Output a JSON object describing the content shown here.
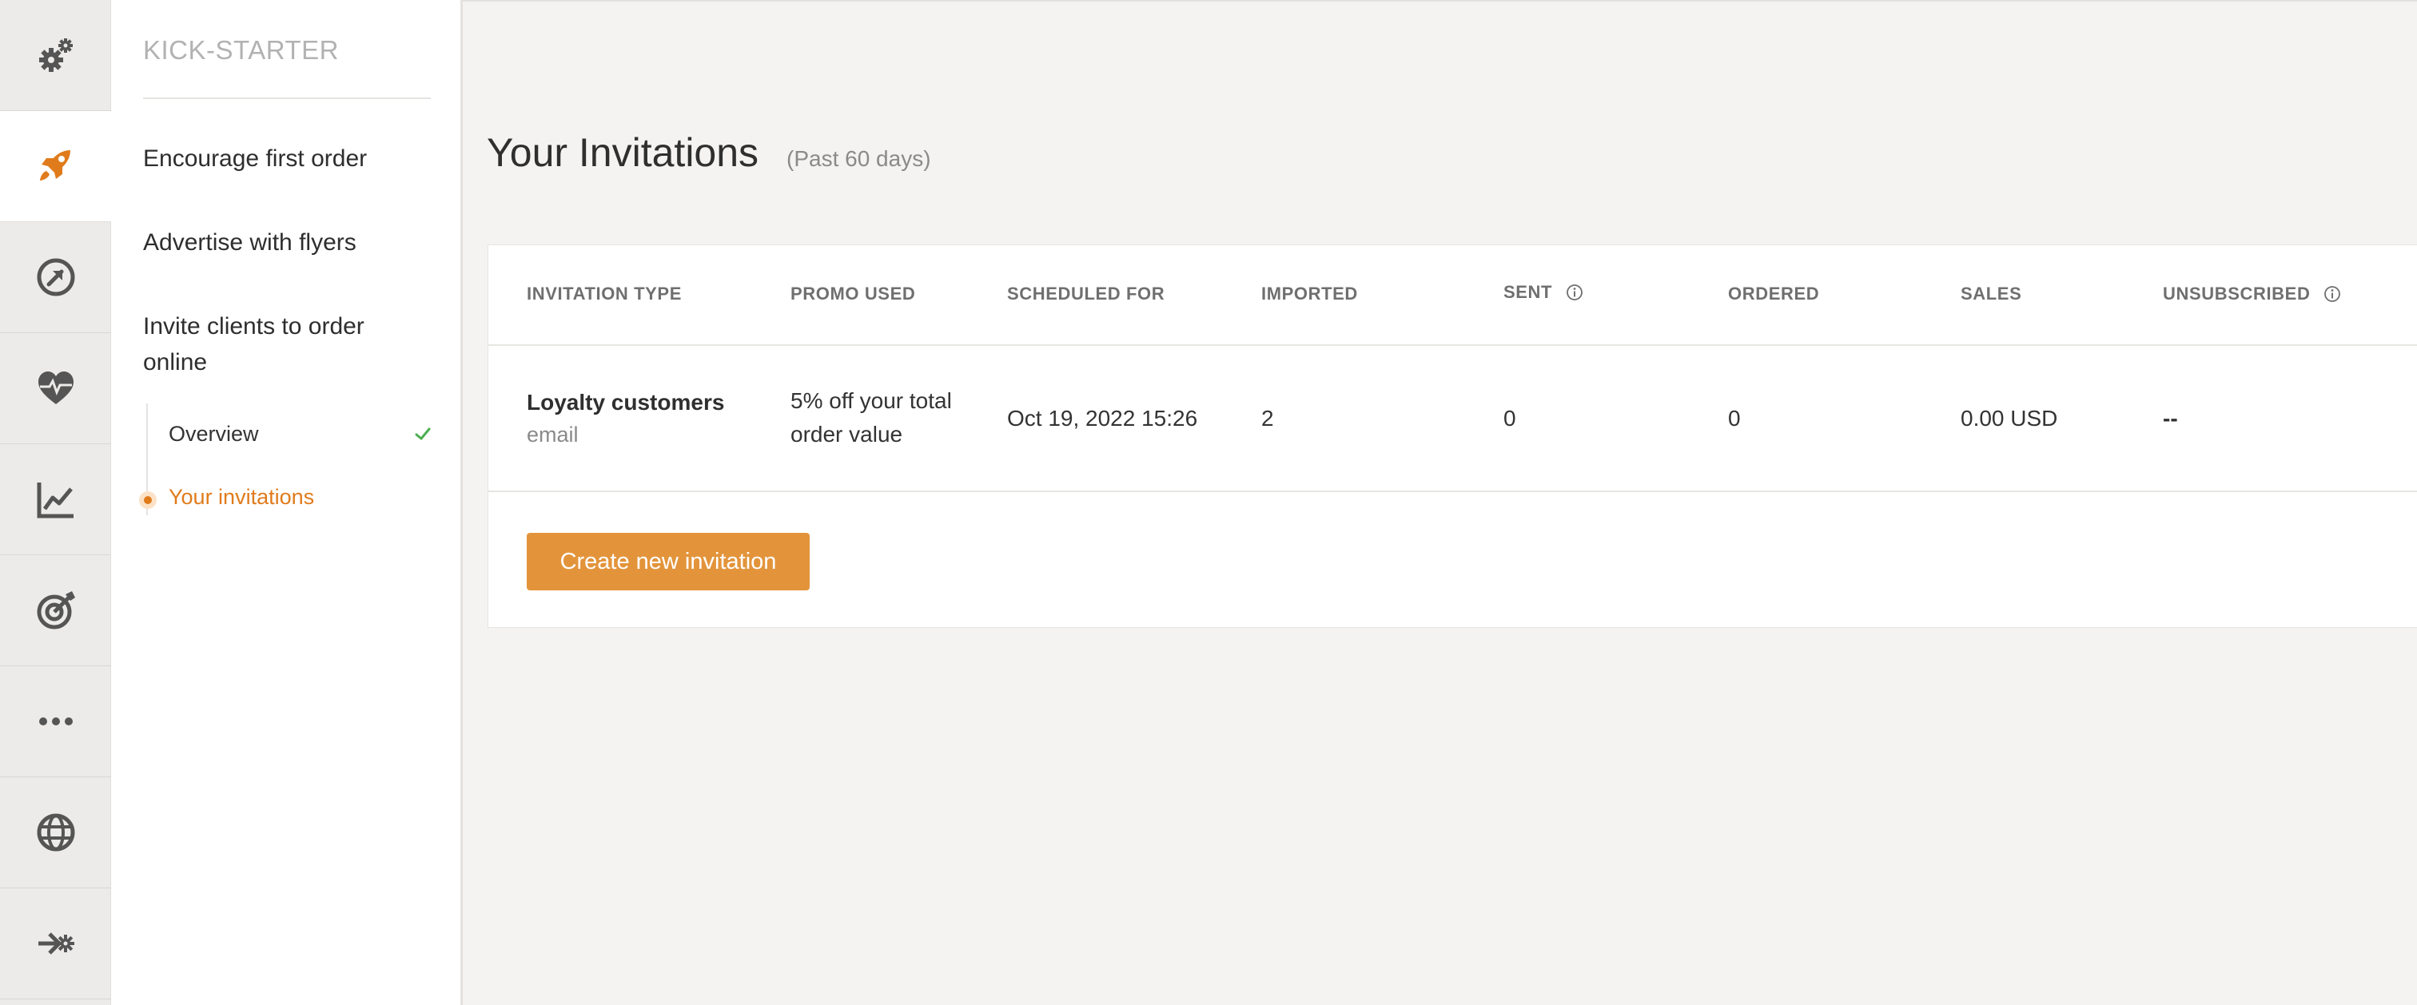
{
  "rail": {
    "items": [
      {
        "icon": "gears-icon",
        "active": false
      },
      {
        "icon": "rocket-icon",
        "active": true
      },
      {
        "icon": "arrow-circle-icon",
        "active": false
      },
      {
        "icon": "heart-pulse-icon",
        "active": false
      },
      {
        "icon": "line-chart-icon",
        "active": false
      },
      {
        "icon": "target-icon",
        "active": false
      },
      {
        "icon": "more-icon",
        "active": false
      },
      {
        "icon": "globe-icon",
        "active": false
      },
      {
        "icon": "integrations-icon",
        "active": false
      }
    ]
  },
  "subnav": {
    "title": "KICK-STARTER",
    "links": [
      {
        "label": "Encourage first order"
      },
      {
        "label": "Advertise with flyers"
      },
      {
        "label": "Invite clients to order online"
      }
    ],
    "subitems": [
      {
        "label": "Overview",
        "completed": true
      },
      {
        "label": "Your invitations",
        "active": true
      }
    ]
  },
  "main": {
    "title": "Your Invitations",
    "subtitle": "(Past 60 days)",
    "table": {
      "columns": [
        "INVITATION TYPE",
        "PROMO USED",
        "SCHEDULED FOR",
        "IMPORTED",
        "SENT",
        "ORDERED",
        "SALES",
        "UNSUBSCRIBED"
      ],
      "rows": [
        {
          "type": "Loyalty customers",
          "channel": "email",
          "promo_line1": "5% off your total",
          "promo_line2": "order value",
          "scheduled": "Oct 19, 2022 15:26",
          "imported": "2",
          "sent": "0",
          "ordered": "0",
          "sales": "0.00 USD",
          "unsubscribed": "--"
        }
      ]
    },
    "create_button": "Create new invitation"
  },
  "colors": {
    "accent": "#e07b1c",
    "button": "#e3943b",
    "icon": "#555555",
    "check": "#4caf50"
  }
}
